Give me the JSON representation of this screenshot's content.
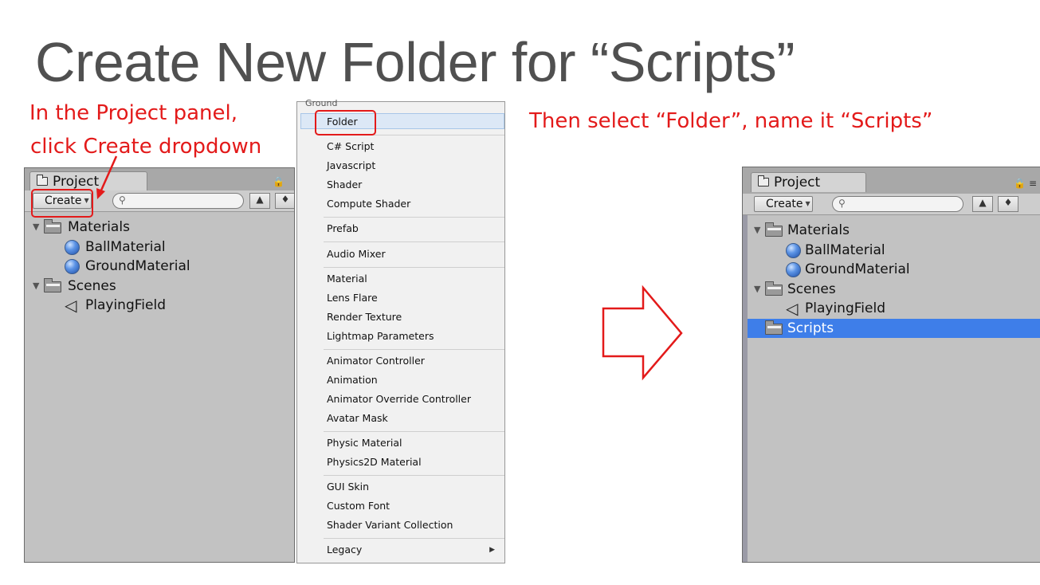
{
  "slide": {
    "title": "Create New Folder for “Scripts”",
    "annotations": {
      "step1_line1": "In the Project panel,",
      "step1_line2": "click Create dropdown",
      "step2": "Then select “Folder”, name it “Scripts”"
    },
    "annotation_color": "#e31a1a"
  },
  "panel_left": {
    "tab_label": "Project",
    "create_label": "Create",
    "tree": [
      {
        "label": "Materials",
        "type": "folder"
      },
      {
        "label": "BallMaterial",
        "type": "material"
      },
      {
        "label": "GroundMaterial",
        "type": "material"
      },
      {
        "label": "Scenes",
        "type": "folder"
      },
      {
        "label": "PlayingField",
        "type": "scene"
      }
    ]
  },
  "menu": {
    "header": "Ground",
    "items": [
      "Folder",
      "C# Script",
      "Javascript",
      "Shader",
      "Compute Shader",
      "Prefab",
      "Audio Mixer",
      "Material",
      "Lens Flare",
      "Render Texture",
      "Lightmap Parameters",
      "Animator Controller",
      "Animation",
      "Animator Override Controller",
      "Avatar Mask",
      "Physic Material",
      "Physics2D Material",
      "GUI Skin",
      "Custom Font",
      "Shader Variant Collection",
      "Legacy"
    ],
    "highlighted": "Folder"
  },
  "panel_right": {
    "tab_label": "Project",
    "create_label": "Create",
    "tree": [
      {
        "label": "Materials",
        "type": "folder"
      },
      {
        "label": "BallMaterial",
        "type": "material"
      },
      {
        "label": "GroundMaterial",
        "type": "material"
      },
      {
        "label": "Scenes",
        "type": "folder"
      },
      {
        "label": "PlayingField",
        "type": "scene"
      },
      {
        "label": "Scripts",
        "type": "folder",
        "selected": true
      }
    ],
    "selection_color": "#3e7ee9"
  }
}
